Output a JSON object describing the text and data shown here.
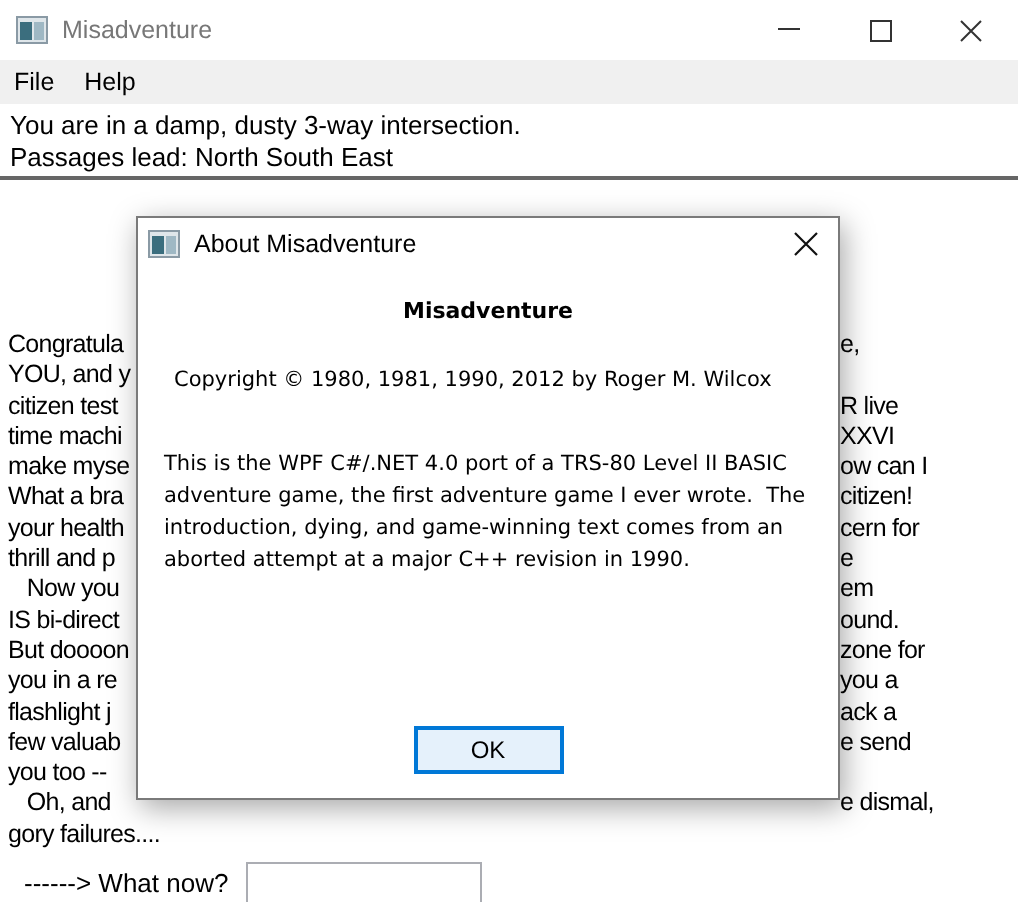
{
  "window": {
    "title": "Misadventure"
  },
  "menu": [
    "File",
    "Help"
  ],
  "location": [
    "You are in a damp, dusty 3-way intersection.",
    "Passages lead: North South East"
  ],
  "story_lines": [
    {
      "left": "Congratula",
      "right": "e,"
    },
    {
      "left": "YOU, and y"
    },
    {
      "left": "citizen test",
      "right": "R live"
    },
    {
      "left": "time machi",
      "right": "XXVI"
    },
    {
      "left": "make myse",
      "right": "ow can I"
    },
    {
      "left": "What a bra",
      "right": "citizen!"
    },
    {
      "left": "your health",
      "right": "cern for"
    },
    {
      "left": "thrill and p",
      "right": "e"
    },
    {
      "left": "   Now you",
      "right": "em"
    },
    {
      "left": "IS bi-direct",
      "right": "ound."
    },
    {
      "left": "But doooon",
      "right": "zone for"
    },
    {
      "left": "you in a re",
      "right": "you a"
    },
    {
      "left": "flashlight j",
      "right": "ack a"
    },
    {
      "left": "few valuab",
      "right": "e send"
    },
    {
      "left": "you too --"
    },
    {
      "left": "   Oh, and",
      "right": "e dismal,"
    },
    {
      "left": "gory failures...."
    }
  ],
  "prompt": {
    "label": "------> What now?"
  },
  "dialog": {
    "title": "About Misadventure",
    "heading": "Misadventure",
    "copyright": "Copyright © 1980, 1981, 1990, 2012 by Roger M. Wilcox",
    "description": "This is the WPF C#/.NET 4.0 port of a TRS-80 Level II BASIC adventure game, the first adventure game I ever wrote.  The introduction, dying, and game-winning text comes from an aborted attempt at a major C++ revision in 1990.",
    "buttons": [
      {
        "label": "OK",
        "selected": true
      }
    ]
  }
}
